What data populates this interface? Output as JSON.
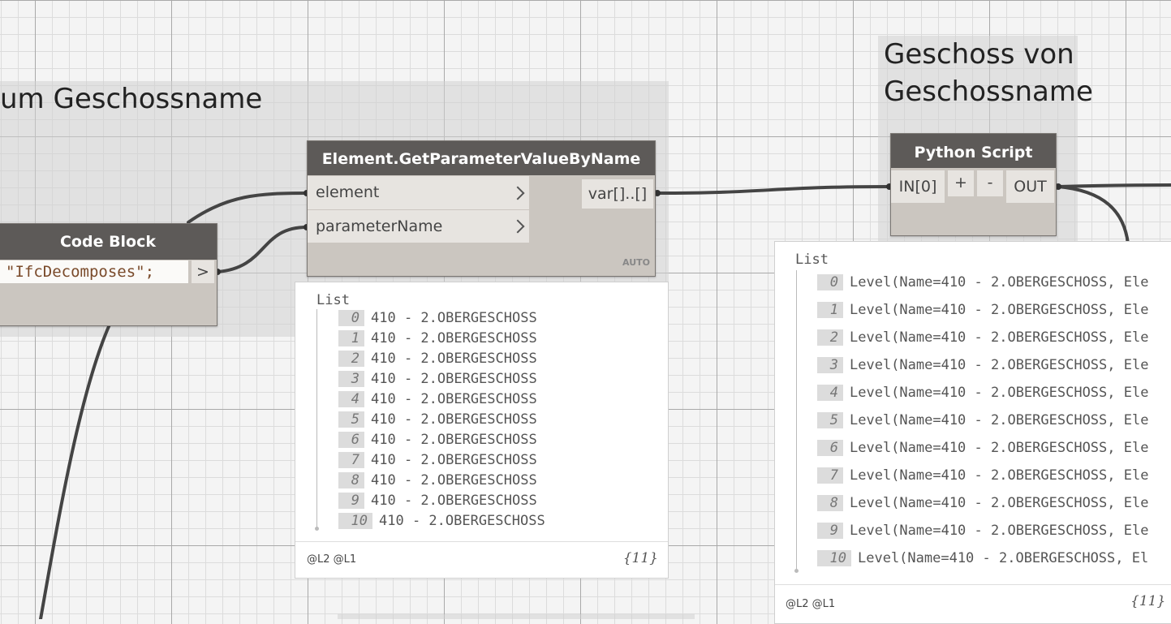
{
  "groups": {
    "left_title": "um Geschossname",
    "right_title_line1": "Geschoss von",
    "right_title_line2": "Geschossname"
  },
  "code_block": {
    "title": "Code Block",
    "code": "\"IfcDecomposes\";",
    "output_port": ">"
  },
  "get_param_node": {
    "title": "Element.GetParameterValueByName",
    "inputs": [
      "element",
      "parameterName"
    ],
    "output": "var[]..[]",
    "lacing": "AUTO",
    "preview": {
      "list_label": "List",
      "items": [
        {
          "index": "0",
          "value": "410 - 2.OBERGESCHOSS"
        },
        {
          "index": "1",
          "value": "410 - 2.OBERGESCHOSS"
        },
        {
          "index": "2",
          "value": "410 - 2.OBERGESCHOSS"
        },
        {
          "index": "3",
          "value": "410 - 2.OBERGESCHOSS"
        },
        {
          "index": "4",
          "value": "410 - 2.OBERGESCHOSS"
        },
        {
          "index": "5",
          "value": "410 - 2.OBERGESCHOSS"
        },
        {
          "index": "6",
          "value": "410 - 2.OBERGESCHOSS"
        },
        {
          "index": "7",
          "value": "410 - 2.OBERGESCHOSS"
        },
        {
          "index": "8",
          "value": "410 - 2.OBERGESCHOSS"
        },
        {
          "index": "9",
          "value": "410 - 2.OBERGESCHOSS"
        },
        {
          "index": "10",
          "value": "410 - 2.OBERGESCHOSS"
        }
      ],
      "levels": "@L2 @L1",
      "count": "{11}"
    }
  },
  "python_node": {
    "title": "Python Script",
    "input": "IN[0]",
    "add_label": "+",
    "remove_label": "-",
    "output": "OUT",
    "preview": {
      "list_label": "List",
      "items": [
        {
          "index": "0",
          "value": "Level(Name=410 - 2.OBERGESCHOSS, Ele"
        },
        {
          "index": "1",
          "value": "Level(Name=410 - 2.OBERGESCHOSS, Ele"
        },
        {
          "index": "2",
          "value": "Level(Name=410 - 2.OBERGESCHOSS, Ele"
        },
        {
          "index": "3",
          "value": "Level(Name=410 - 2.OBERGESCHOSS, Ele"
        },
        {
          "index": "4",
          "value": "Level(Name=410 - 2.OBERGESCHOSS, Ele"
        },
        {
          "index": "5",
          "value": "Level(Name=410 - 2.OBERGESCHOSS, Ele"
        },
        {
          "index": "6",
          "value": "Level(Name=410 - 2.OBERGESCHOSS, Ele"
        },
        {
          "index": "7",
          "value": "Level(Name=410 - 2.OBERGESCHOSS, Ele"
        },
        {
          "index": "8",
          "value": "Level(Name=410 - 2.OBERGESCHOSS, Ele"
        },
        {
          "index": "9",
          "value": "Level(Name=410 - 2.OBERGESCHOSS, Ele"
        },
        {
          "index": "10",
          "value": "Level(Name=410 - 2.OBERGESCHOSS, El"
        }
      ],
      "levels": "@L2 @L1",
      "count": "{11}"
    }
  },
  "colors": {
    "node_header": "#5d5a58",
    "node_body": "#cbc6c0",
    "port_bg": "#e7e4e0",
    "wire": "#444444",
    "group_bg": "#d2d2d2"
  }
}
